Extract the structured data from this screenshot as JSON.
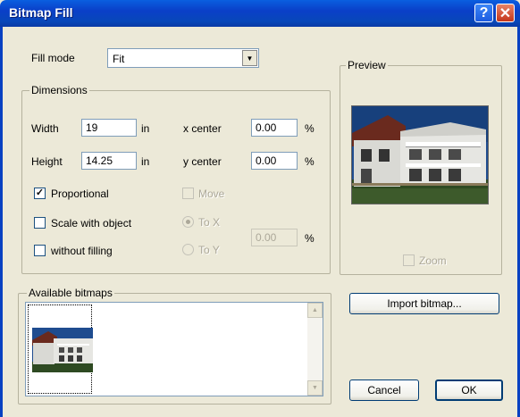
{
  "window": {
    "title": "Bitmap Fill",
    "help_glyph": "?",
    "close_glyph": "✕"
  },
  "fill_mode": {
    "label": "Fill mode",
    "value": "Fit"
  },
  "dimensions": {
    "group_title": "Dimensions",
    "width_label": "Width",
    "width_value": "19",
    "width_unit": "in",
    "height_label": "Height",
    "height_value": "14.25",
    "height_unit": "in",
    "x_center_label": "x center",
    "x_center_value": "0.00",
    "x_center_unit": "%",
    "y_center_label": "y center",
    "y_center_value": "0.00",
    "y_center_unit": "%",
    "proportional_label": "Proportional",
    "proportional_checked": true,
    "scale_with_object_label": "Scale with object",
    "scale_with_object_checked": false,
    "without_filling_label": "without filling",
    "without_filling_checked": false,
    "move_label": "Move",
    "move_checked": false,
    "to_x_label": "To X",
    "to_x_selected": true,
    "to_y_label": "To Y",
    "to_y_selected": false,
    "move_value": "0.00",
    "move_unit": "%"
  },
  "preview": {
    "group_title": "Preview",
    "zoom_label": "Zoom",
    "zoom_checked": false,
    "check_glyph": "✓"
  },
  "bitmaps": {
    "group_title": "Available bitmaps"
  },
  "buttons": {
    "import": "Import bitmap...",
    "cancel": "Cancel",
    "ok": "OK"
  },
  "icons": {
    "dropdown": "chevron-down-icon",
    "scroll_up": "scroll-up-icon",
    "scroll_down": "scroll-down-icon"
  },
  "colors": {
    "titlebar": "#0a3fc8",
    "dialog_bg": "#ece9d8",
    "close_button": "#c4361a",
    "field_border": "#7f9db9"
  }
}
